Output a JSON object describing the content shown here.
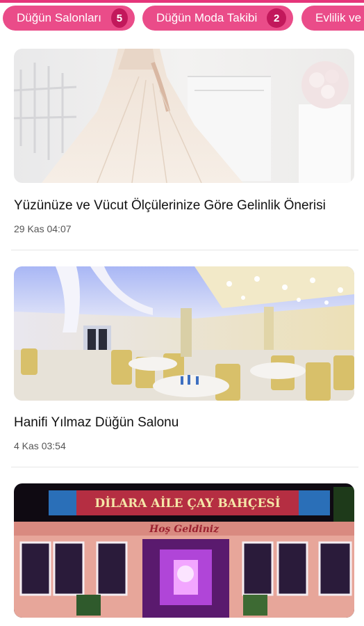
{
  "categories": [
    {
      "label": "Düğün Salonları",
      "count": "5"
    },
    {
      "label": "Düğün Moda Takibi",
      "count": "2"
    },
    {
      "label": "Evlilik ve",
      "count": ""
    }
  ],
  "articles": [
    {
      "title": "Yüzünüze ve Vücut Ölçülerinize Göre Gelinlik Önerisi",
      "date": "29 Kas 04:07",
      "image": "wedding-dress-photo"
    },
    {
      "title": "Hanifi Yılmaz Düğün Salonu",
      "date": "4 Kas 03:54",
      "image": "wedding-hall-photo"
    },
    {
      "title": "",
      "date": "",
      "image": "tea-garden-photo",
      "sign_text": "DİLARA AİLE ÇAY BAHÇESİ",
      "welcome_text": "Hoş Geldiniz"
    }
  ],
  "colors": {
    "accent": "#ea4c89",
    "badge": "#c2185b"
  }
}
